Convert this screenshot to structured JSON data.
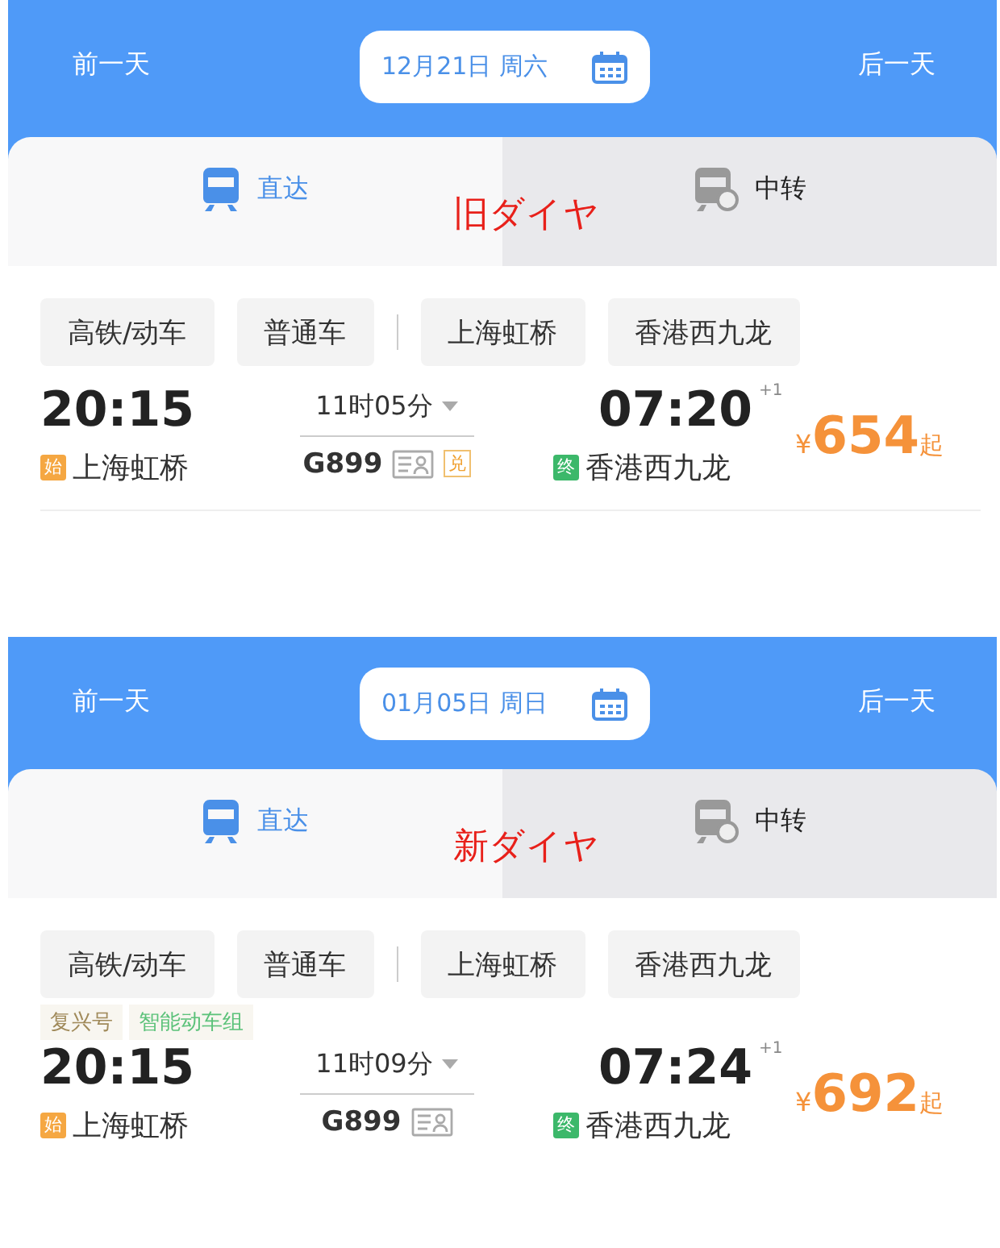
{
  "panels": [
    {
      "prev_day": "前一天",
      "date": "12月21日 周六",
      "next_day": "后一天",
      "tabs": [
        {
          "label": "直达",
          "selected": true
        },
        {
          "label": "中转",
          "selected": false
        }
      ],
      "annotation": "旧ダイヤ",
      "filter_groups": [
        [
          "高铁/动车",
          "普通车"
        ],
        [
          "上海虹桥",
          "香港西九龙"
        ]
      ],
      "train": {
        "depart": "20:15",
        "from_marker": "始",
        "from": "上海虹桥",
        "duration": "11时05分",
        "train_no": "G899",
        "badges": [
          "兑"
        ],
        "arrive": "07:20",
        "day_offset": "+1",
        "to_marker": "终",
        "to": "香港西九龙",
        "currency": "¥",
        "price": "654",
        "price_suffix": "起"
      }
    },
    {
      "prev_day": "前一天",
      "date": "01月05日 周日",
      "next_day": "后一天",
      "tabs": [
        {
          "label": "直达",
          "selected": true
        },
        {
          "label": "中转",
          "selected": false
        }
      ],
      "annotation": "新ダイヤ",
      "filter_groups": [
        [
          "高铁/动车",
          "普通车"
        ],
        [
          "上海虹桥",
          "香港西九龙"
        ]
      ],
      "train": {
        "tags": [
          {
            "label": "复兴号",
            "color": "#a08a5a"
          },
          {
            "label": "智能动车组",
            "color": "#5cc27a"
          }
        ],
        "depart": "20:15",
        "from_marker": "始",
        "from": "上海虹桥",
        "duration": "11时09分",
        "train_no": "G899",
        "arrive": "07:24",
        "day_offset": "+1",
        "to_marker": "终",
        "to": "香港西九龙",
        "currency": "¥",
        "price": "692",
        "price_suffix": "起"
      }
    }
  ]
}
